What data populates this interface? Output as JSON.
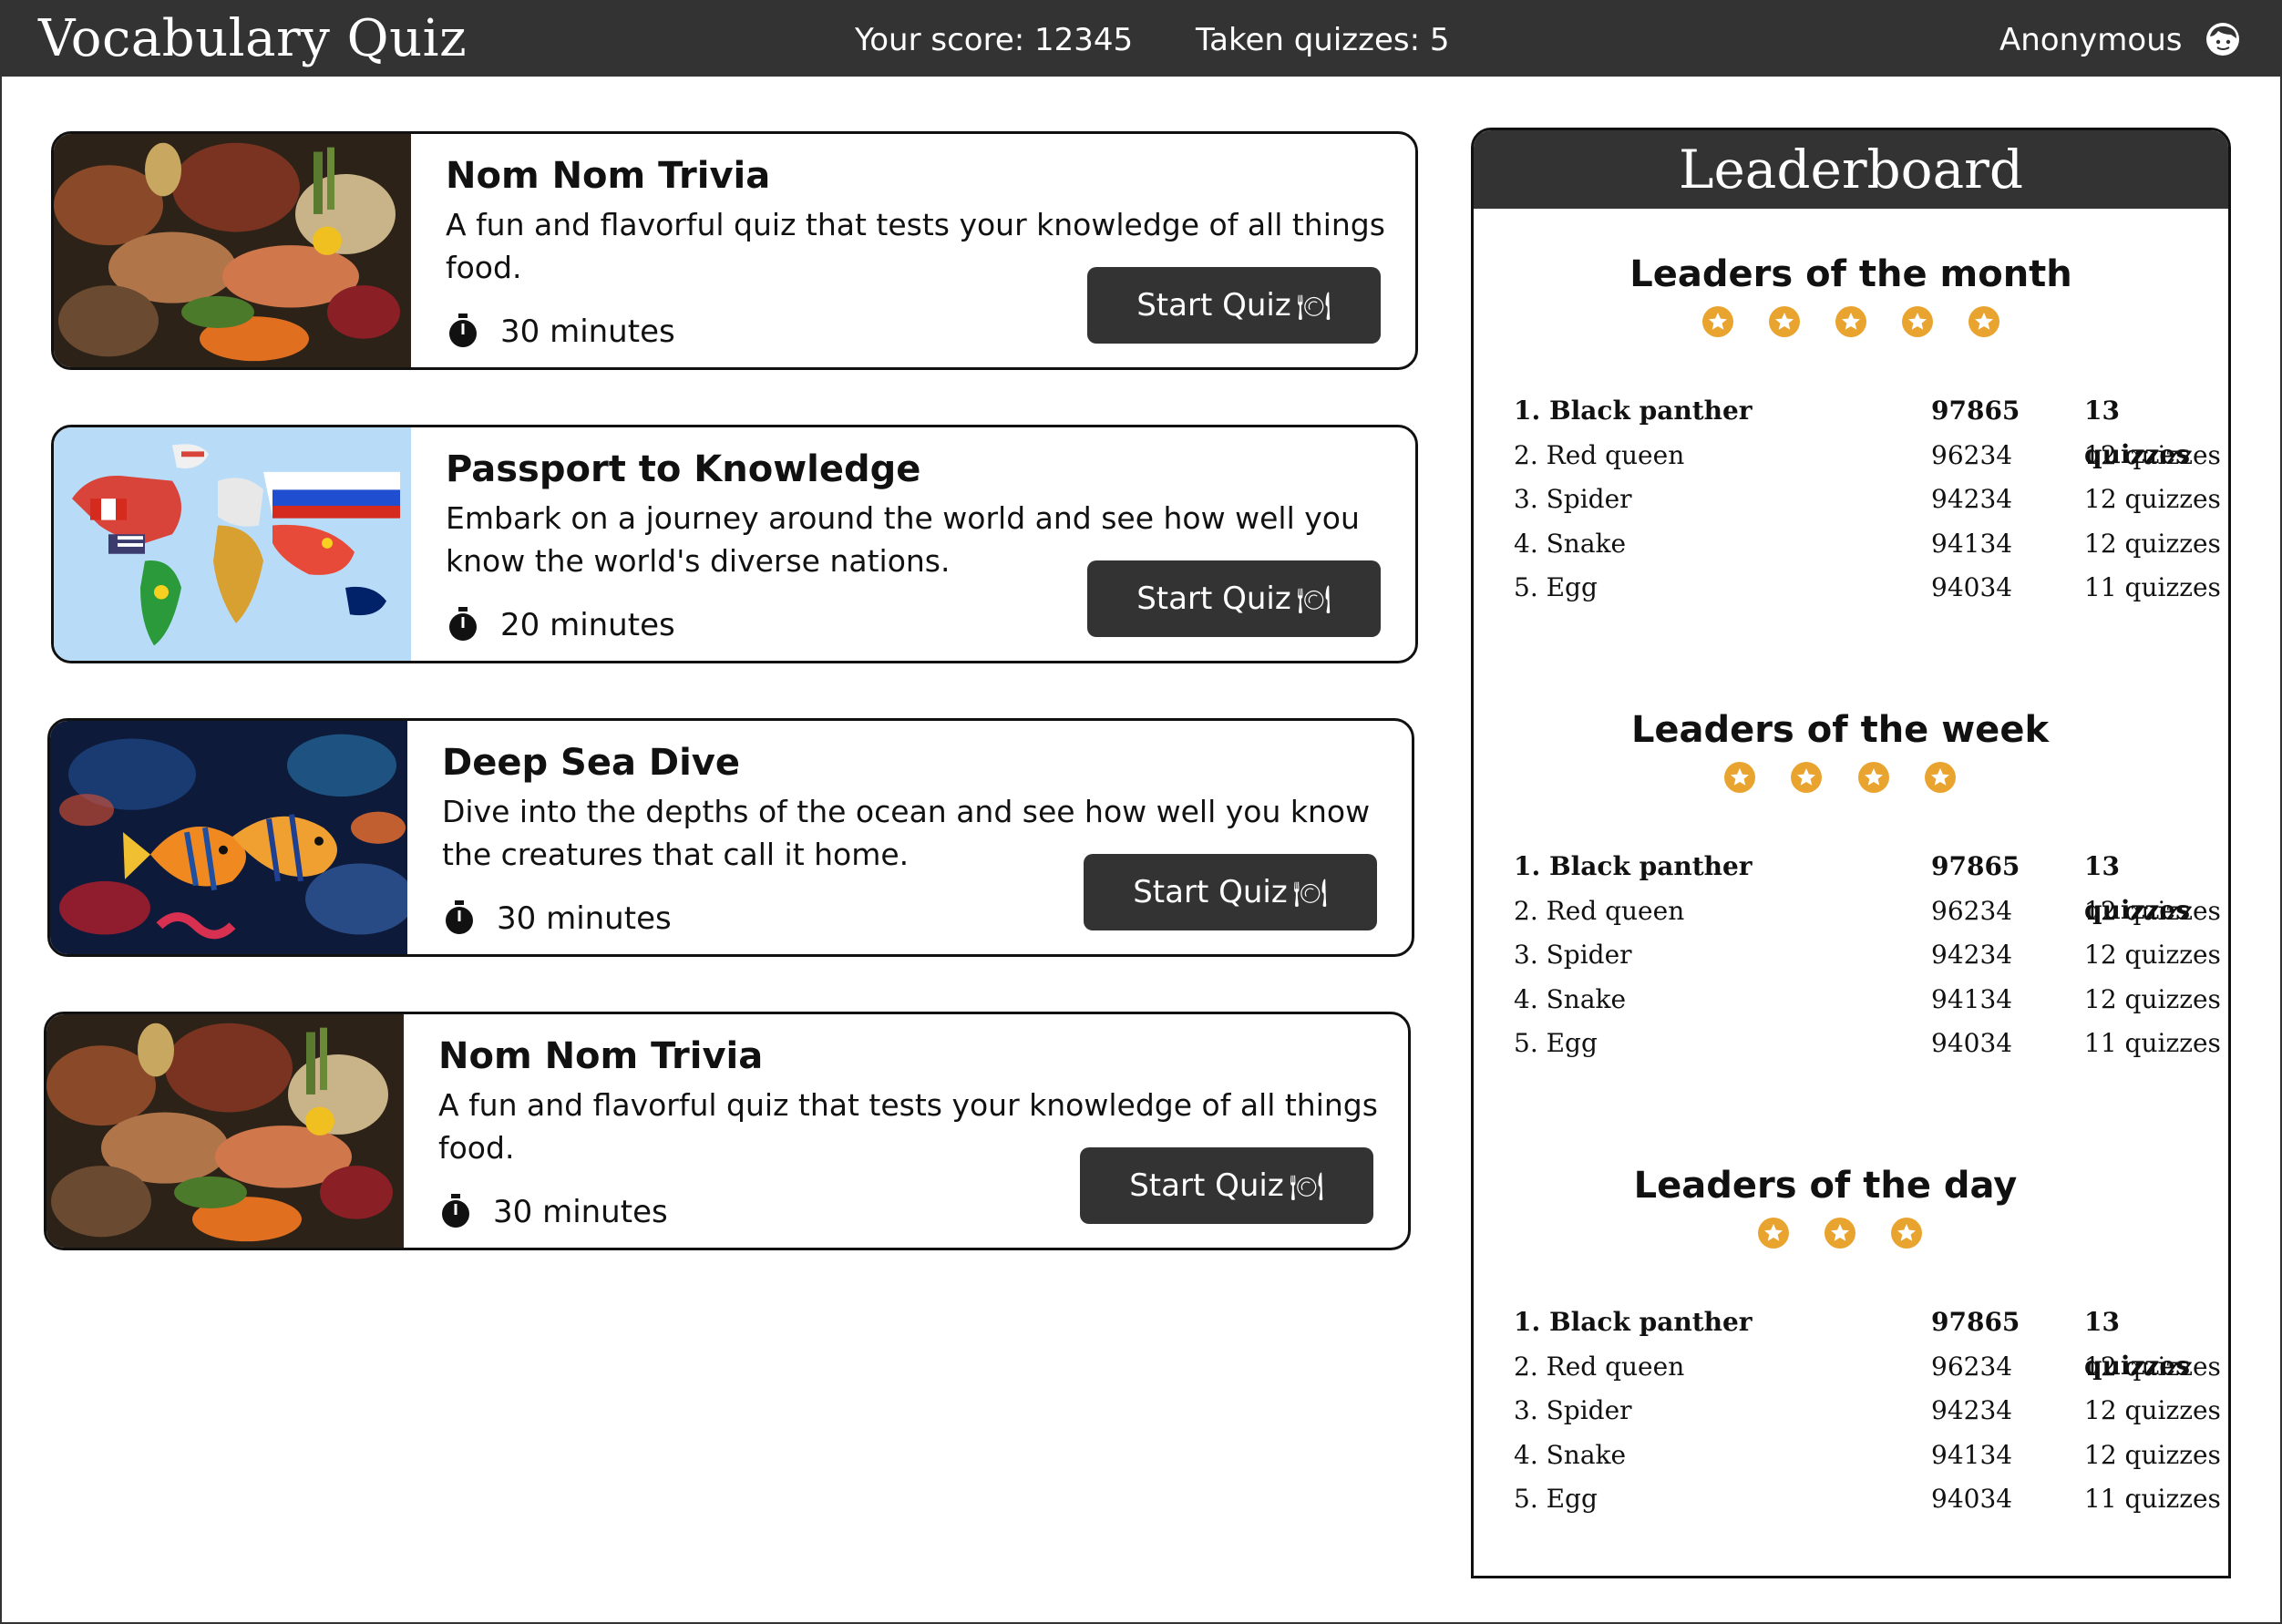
{
  "header": {
    "app_title": "Vocabulary Quiz",
    "score_text": "Your score: 12345",
    "taken_text": "Taken quizzes: 5",
    "user_name": "Anonymous",
    "user_icon": "user-face-icon"
  },
  "quizzes": [
    {
      "title": "Nom Nom Trivia",
      "description": "A fun and flavorful quiz that tests your knowledge of all things food.",
      "duration": "30 minutes",
      "button_label": "Start Quiz",
      "thumbnail": "food-image"
    },
    {
      "title": "Passport to Knowledge",
      "description": "Embark on a journey around the world and see how well you know the world's diverse nations.",
      "duration": "20 minutes",
      "button_label": "Start Quiz",
      "thumbnail": "world-flags-map-image"
    },
    {
      "title": "Deep Sea Dive",
      "description": "Dive into the depths of the ocean and see how well you know the creatures that call it home.",
      "duration": "30 minutes",
      "button_label": "Start Quiz",
      "thumbnail": "tropical-fish-image"
    },
    {
      "title": "Nom Nom Trivia",
      "description": "A fun and flavorful quiz that tests your knowledge of all things food.",
      "duration": "30 minutes",
      "button_label": "Start Quiz",
      "thumbnail": "food-image"
    }
  ],
  "leaderboard": {
    "title": "Leaderboard",
    "star_color": "#E9A430",
    "sections": [
      {
        "title": "Leaders of the month",
        "stars": 5,
        "rows": [
          {
            "name": "1. Black panther",
            "score": "97865",
            "quizzes": "13 quizzes"
          },
          {
            "name": "2. Red queen",
            "score": "96234",
            "quizzes": "12 quizzes"
          },
          {
            "name": "3. Spider",
            "score": "94234",
            "quizzes": "12 quizzes"
          },
          {
            "name": "4. Snake",
            "score": "94134",
            "quizzes": "12 quizzes"
          },
          {
            "name": "5. Egg",
            "score": "94034",
            "quizzes": "11 quizzes"
          }
        ]
      },
      {
        "title": "Leaders of the week",
        "stars": 4,
        "rows": [
          {
            "name": "1. Black panther",
            "score": "97865",
            "quizzes": "13 quizzes"
          },
          {
            "name": "2. Red queen",
            "score": "96234",
            "quizzes": "12 quizzes"
          },
          {
            "name": "3. Spider",
            "score": "94234",
            "quizzes": "12 quizzes"
          },
          {
            "name": "4. Snake",
            "score": "94134",
            "quizzes": "12 quizzes"
          },
          {
            "name": "5. Egg",
            "score": "94034",
            "quizzes": "11 quizzes"
          }
        ]
      },
      {
        "title": "Leaders of the day",
        "stars": 3,
        "rows": [
          {
            "name": "1. Black panther",
            "score": "97865",
            "quizzes": "13 quizzes"
          },
          {
            "name": "2. Red queen",
            "score": "96234",
            "quizzes": "12 quizzes"
          },
          {
            "name": "3. Spider",
            "score": "94234",
            "quizzes": "12 quizzes"
          },
          {
            "name": "4. Snake",
            "score": "94134",
            "quizzes": "12 quizzes"
          },
          {
            "name": "5. Egg",
            "score": "94034",
            "quizzes": "11 quizzes"
          }
        ]
      }
    ]
  }
}
